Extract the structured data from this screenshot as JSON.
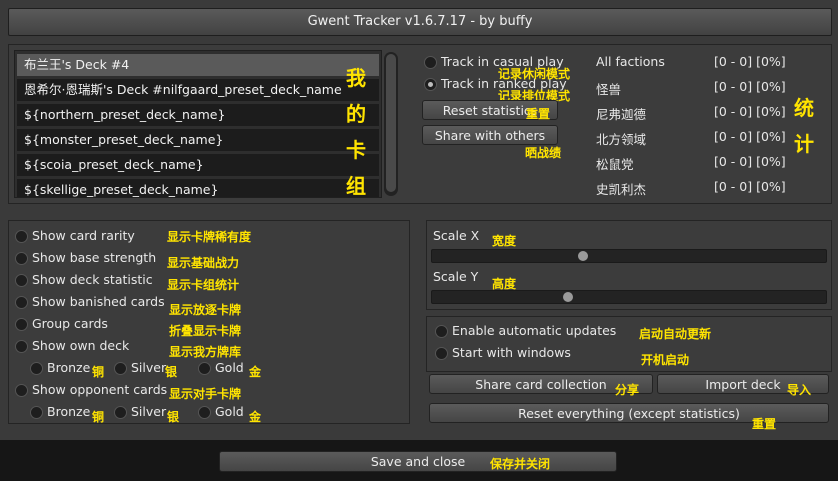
{
  "window": {
    "title": "Gwent Tracker v1.6.7.17 - by buffy"
  },
  "decks": [
    "布兰王's Deck #4",
    "恩希尔·恩瑞斯's Deck #nilfgaard_preset_deck_name",
    "${northern_preset_deck_name}",
    "${monster_preset_deck_name}",
    "${scoia_preset_deck_name}",
    "${skellige_preset_deck_name}"
  ],
  "selected_deck_index": 0,
  "annotations": {
    "my_decks": [
      "我",
      "的",
      "卡",
      "组"
    ],
    "stats": [
      "统",
      "计"
    ],
    "casual": "记录休闲模式",
    "ranked": "记录排位模式",
    "reset_stats": "重置",
    "share": "晒战绩",
    "rarity": "显示卡牌稀有度",
    "base_strength": "显示基础战力",
    "deck_stat": "显示卡组统计",
    "banished": "显示放逐卡牌",
    "group": "折叠显示卡牌",
    "own_deck": "显示我方牌库",
    "bronze": "铜",
    "silver": "银",
    "gold": "金",
    "opponent": "显示对手卡牌",
    "scale_x": "宽度",
    "scale_y": "高度",
    "auto_update": "启动自动更新",
    "start_windows": "开机启动",
    "share_collection": "分享",
    "import_deck": "导入",
    "reset_all": "重置",
    "save_close": "保存并关闭"
  },
  "tracking": {
    "casual_label": "Track in casual play",
    "ranked_label": "Track in ranked play",
    "casual_checked": false,
    "ranked_checked": true,
    "reset_button": "Reset statistics",
    "share_button": "Share with others"
  },
  "statistics": [
    {
      "faction": "All factions",
      "value": "[0 - 0] [0%]"
    },
    {
      "faction": "怪兽",
      "value": "[0 - 0] [0%]"
    },
    {
      "faction": "尼弗迦德",
      "value": "[0 - 0] [0%]"
    },
    {
      "faction": "北方领域",
      "value": "[0 - 0] [0%]"
    },
    {
      "faction": "松鼠党",
      "value": "[0 - 0] [0%]"
    },
    {
      "faction": "史凯利杰",
      "value": "[0 - 0] [0%]"
    }
  ],
  "options": {
    "show_card_rarity": "Show card rarity",
    "show_base_strength": "Show base strength",
    "show_deck_statistic": "Show deck statistic",
    "show_banished_cards": "Show banished cards",
    "group_cards": "Group cards",
    "show_own_deck": "Show own deck",
    "bronze": "Bronze",
    "silver": "Silver",
    "gold": "Gold",
    "show_opponent_cards": "Show opponent cards"
  },
  "scale": {
    "x_label": "Scale X",
    "y_label": "Scale Y",
    "x_value": 0.38,
    "y_value": 0.34
  },
  "system": {
    "auto_updates": "Enable automatic updates",
    "start_with_windows": "Start with windows",
    "share_collection": "Share card collection",
    "import_deck": "Import deck",
    "reset_everything": "Reset everything (except statistics)",
    "save_close": "Save and close"
  }
}
